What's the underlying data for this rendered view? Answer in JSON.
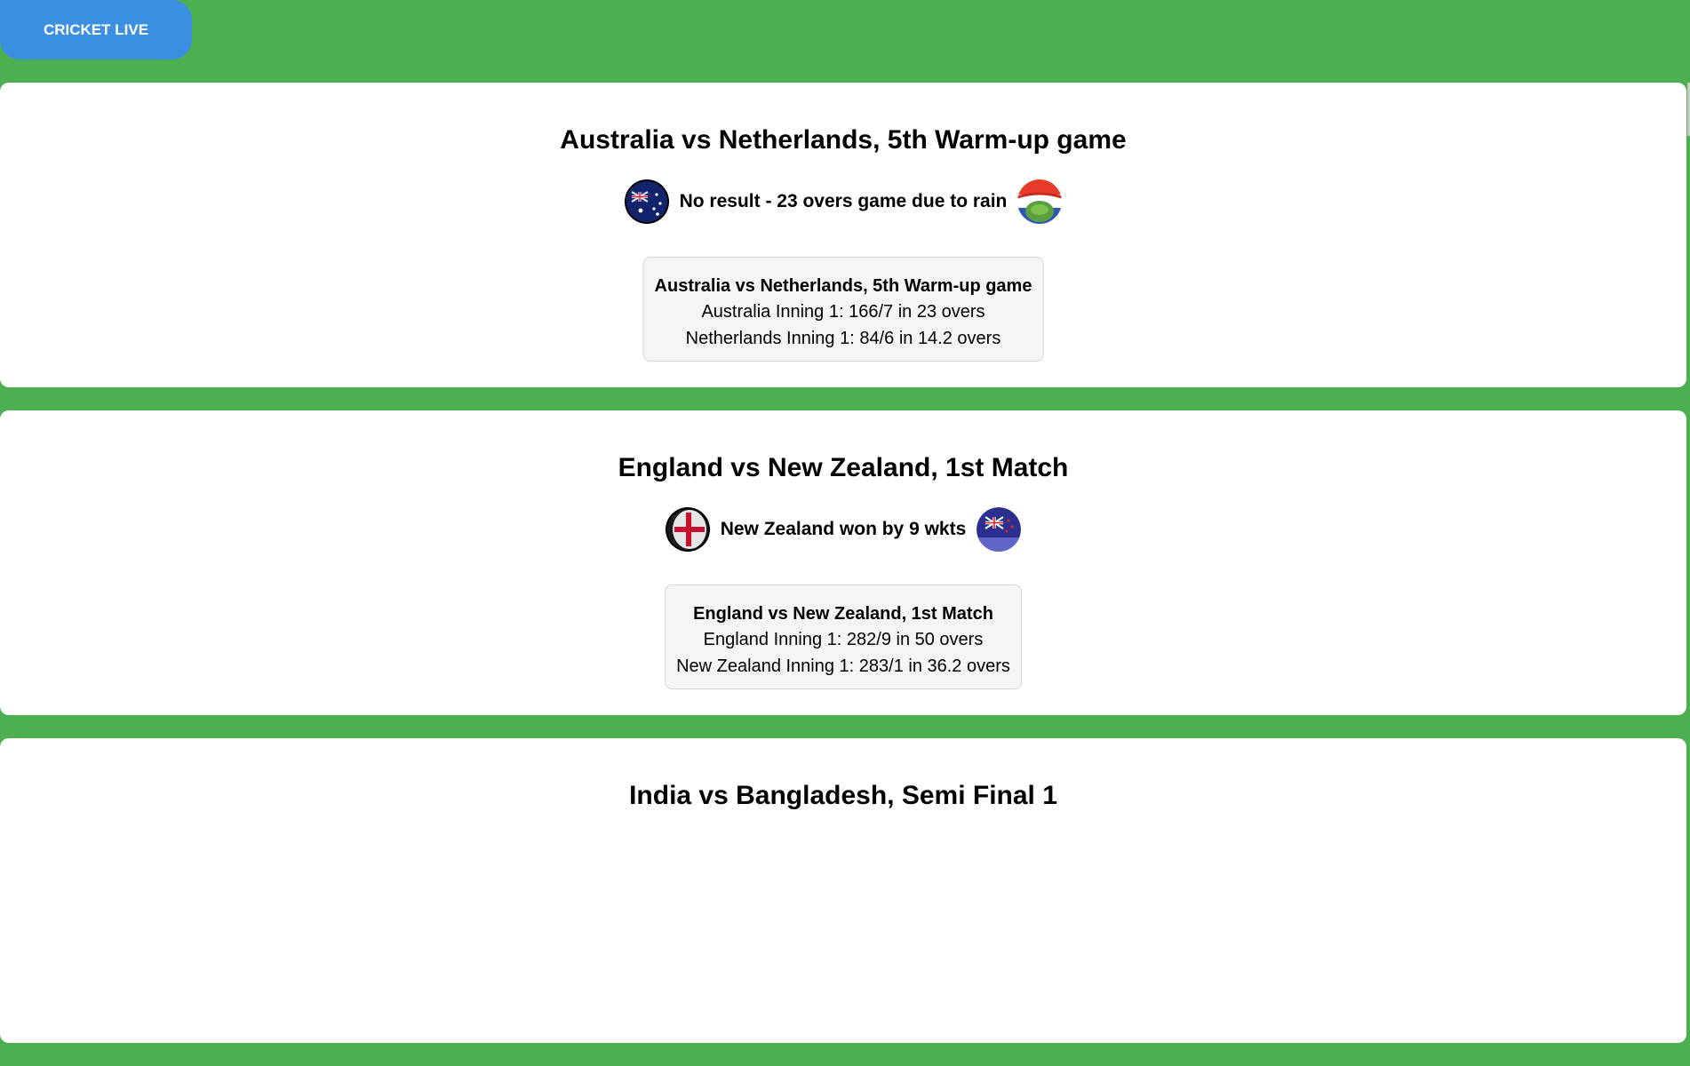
{
  "header": {
    "brand_label": "CRICKET LIVE"
  },
  "matches": [
    {
      "title": "Australia vs Netherlands, 5th Warm-up game",
      "status": "No result - 23 overs game due to rain",
      "team1_flag_icon": "australia-flag-icon",
      "team2_flag_icon": "netherlands-flag-icon",
      "score_title": "Australia vs Netherlands, 5th Warm-up game",
      "innings": [
        "Australia Inning 1: 166/7 in 23 overs",
        "Netherlands Inning 1: 84/6 in 14.2 overs"
      ]
    },
    {
      "title": "England vs New Zealand, 1st Match",
      "status": "New Zealand won by 9 wkts",
      "team1_flag_icon": "england-flag-icon",
      "team2_flag_icon": "new-zealand-flag-icon",
      "score_title": "England vs New Zealand, 1st Match",
      "innings": [
        "England Inning 1: 282/9 in 50 overs",
        "New Zealand Inning 1: 283/1 in 36.2 overs"
      ]
    },
    {
      "title": "India vs Bangladesh, Semi Final 1"
    }
  ],
  "colors": {
    "page_background": "#4caf50",
    "brand_button": "#3a8fe0",
    "card_background": "#ffffff",
    "score_box_background": "#f5f5f5"
  }
}
